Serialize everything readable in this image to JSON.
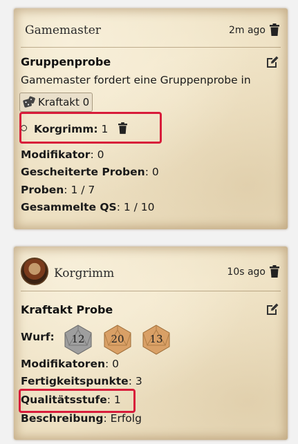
{
  "cards": [
    {
      "sender": "Gamemaster",
      "time": "2m ago",
      "title": "Gruppenprobe",
      "description": "Gamemaster fordert eine Gruppenprobe in",
      "skill_chip": "Kraftakt 0",
      "participant": {
        "name": "Korgrimm:",
        "value": "1"
      },
      "stats": [
        {
          "label": "Modifikator",
          "value": ": 0"
        },
        {
          "label": "Gescheiterte Proben",
          "value": ": 0"
        },
        {
          "label": "Proben",
          "value": ": 1 / 7"
        },
        {
          "label": "Gesammelte QS",
          "value": ": 1 / 10"
        }
      ]
    },
    {
      "sender": "Korgrimm",
      "time": "10s ago",
      "title": "Kraftakt Probe",
      "roll_label": "Wurf:",
      "dice": [
        {
          "value": "12",
          "color": "#9e9e9e"
        },
        {
          "value": "20",
          "color": "#d9a066"
        },
        {
          "value": "13",
          "color": "#d9a066"
        }
      ],
      "stats": [
        {
          "label": "Modifikatoren",
          "value": ": 0"
        },
        {
          "label": "Fertigkeitspunkte",
          "value": ": 3"
        },
        {
          "label": "Qualitätsstufe",
          "value": ": 1"
        },
        {
          "label": "Beschreibung",
          "value": ": Erfolg"
        }
      ]
    }
  ],
  "colors": {
    "highlight": "#d81b3a",
    "parchment": "#ede0c2"
  }
}
